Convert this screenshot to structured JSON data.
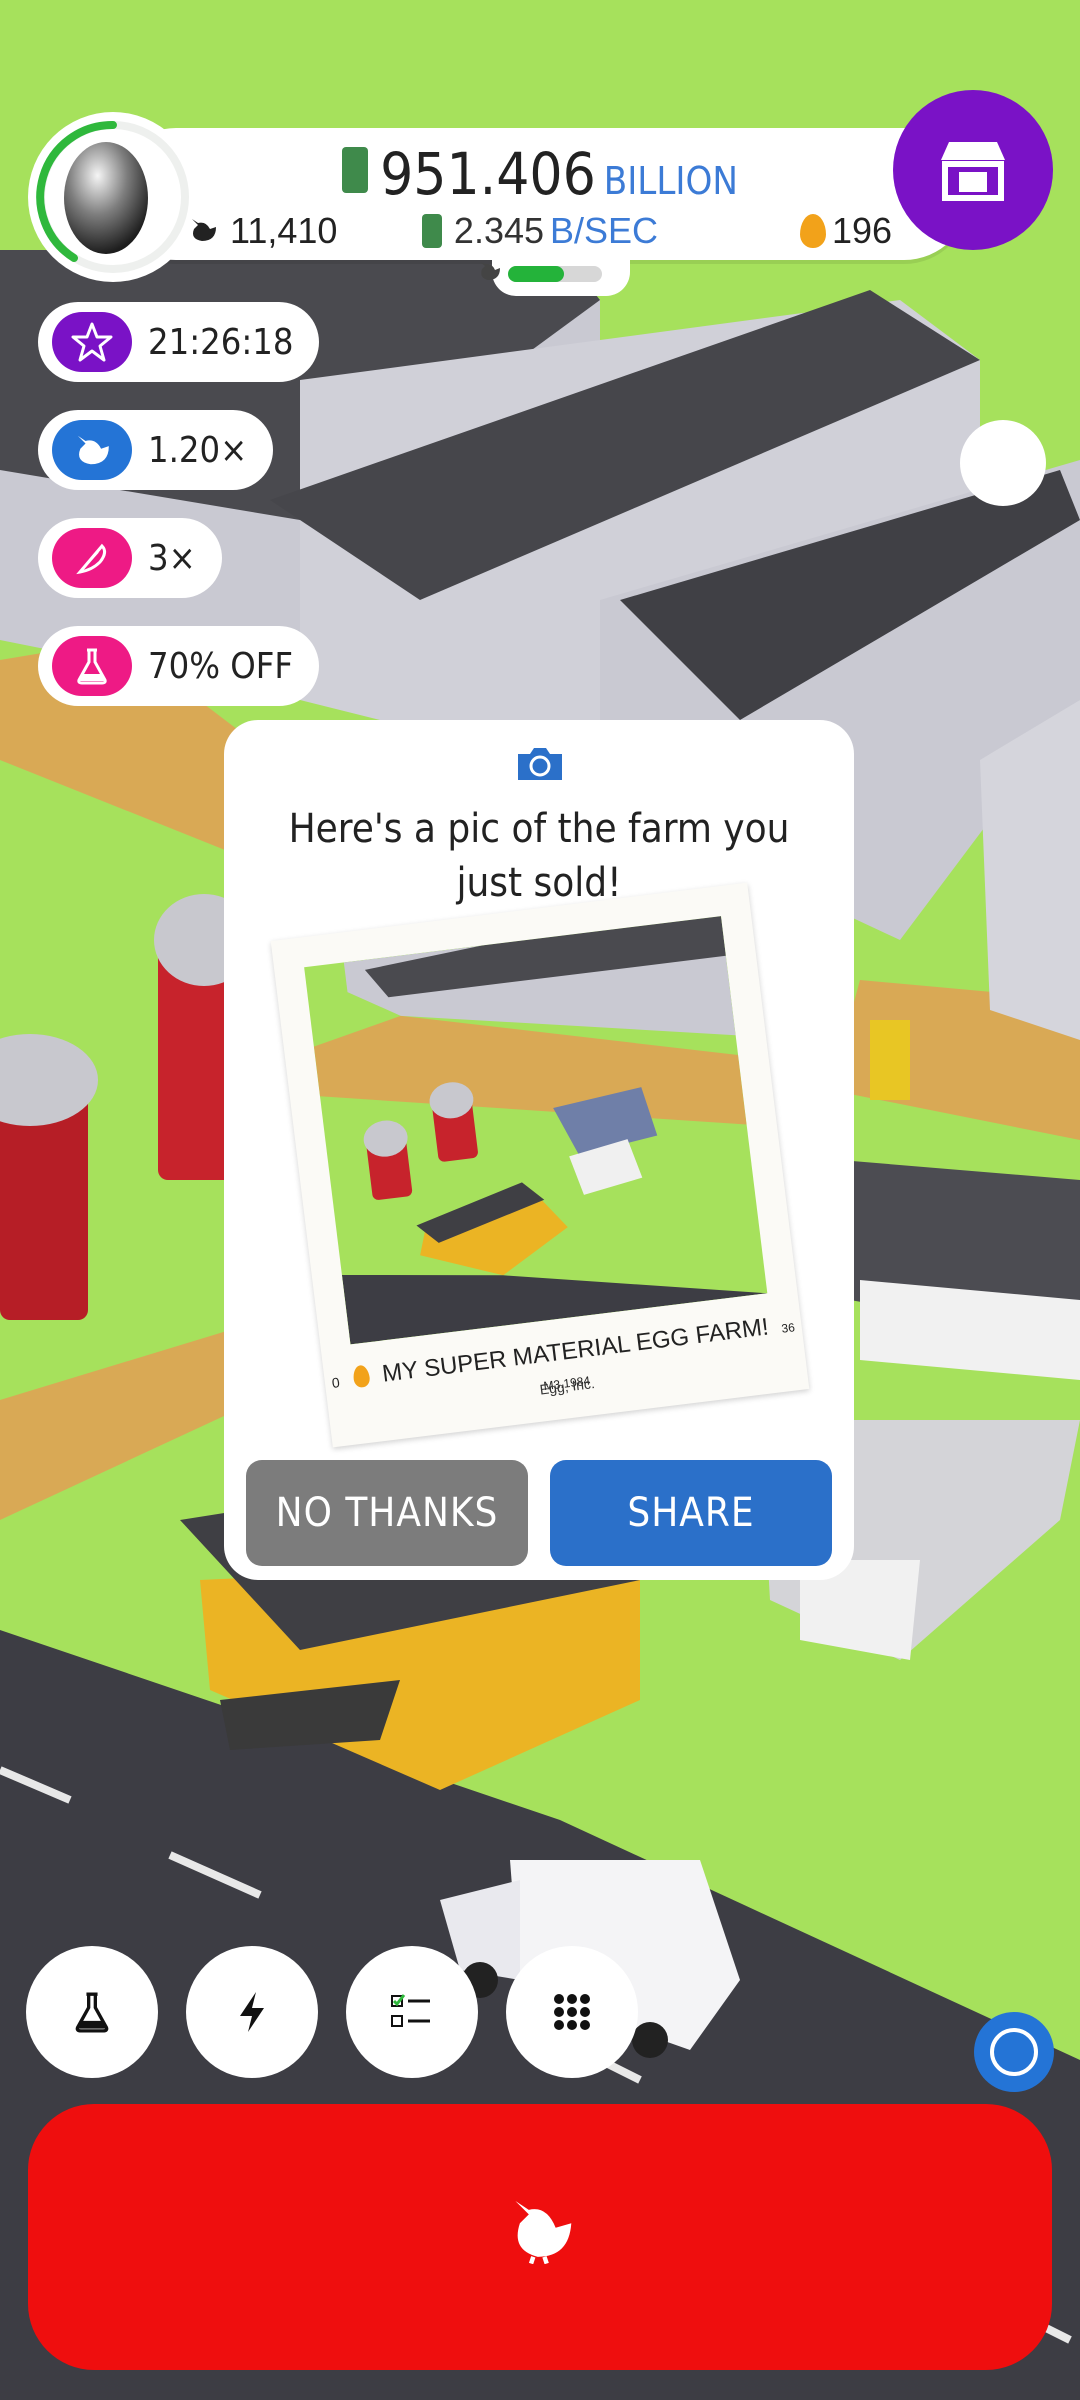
{
  "colors": {
    "grass": "#a6e15c",
    "shop_purple": "#7a12c6",
    "share_blue": "#2b70c9",
    "no_thanks_grey": "#7c7c7c",
    "hatch_red": "#ef0e0e",
    "boost_purple": "#7a12c6",
    "boost_blue": "#2474d6",
    "boost_pink": "#ee1a85"
  },
  "hud": {
    "money_value": "951.406",
    "money_unit": "BILLION",
    "rate_value": "2.345",
    "rate_unit": "B/SEC",
    "chicken_count": "11,410",
    "golden_eggs": "196",
    "egg_type_icon": "egg-icon",
    "shop_icon": "shop-icon",
    "habitat_progress": 0.6
  },
  "boosts": [
    {
      "icon": "star-icon",
      "label": "21:26:18"
    },
    {
      "icon": "chicken-icon",
      "label": "1.20×"
    },
    {
      "icon": "feather-icon",
      "label": "3×"
    },
    {
      "icon": "flask-icon",
      "label": "70% OFF"
    }
  ],
  "popup": {
    "icon": "camera-icon",
    "title_line1": "Here's a pic of the farm you",
    "title_line2": "just sold!",
    "caption": "MY SUPER MATERIAL EGG FARM!",
    "brand": "Egg, Inc.",
    "photo_chickens": "0",
    "photo_stats": "36 M3.1984",
    "no_thanks_label": "NO THANKS",
    "share_label": "SHARE"
  },
  "bottom_bar": {
    "buttons": [
      {
        "icon": "flask-icon"
      },
      {
        "icon": "lightning-icon"
      },
      {
        "icon": "checklist-icon"
      },
      {
        "icon": "grid-menu-icon"
      }
    ],
    "hatch_icon": "chicken-icon"
  }
}
